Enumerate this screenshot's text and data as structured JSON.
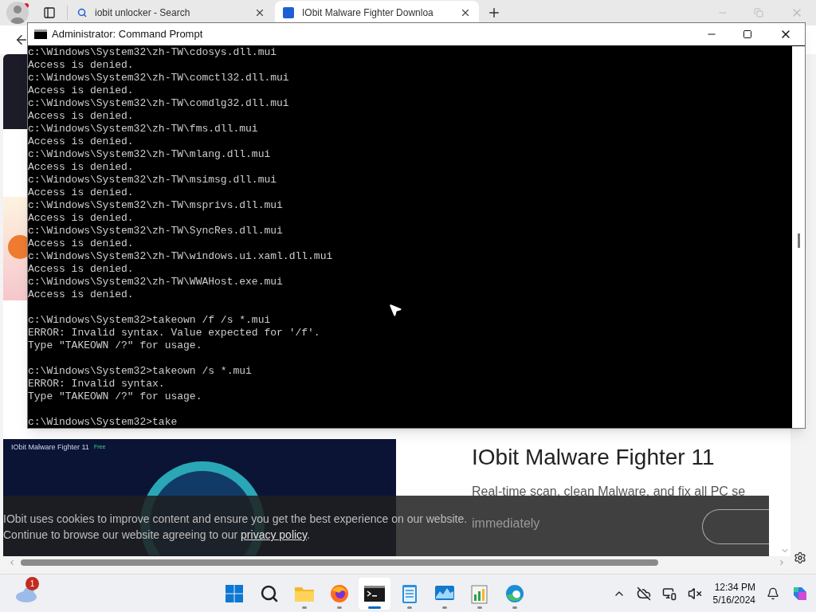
{
  "browser": {
    "tabs": [
      {
        "title": "iobit unlocker - Search",
        "selected": false,
        "kind": "search"
      },
      {
        "title": "IObit Malware Fighter Downloa",
        "selected": true,
        "kind": "site"
      }
    ],
    "page": {
      "app_shot": {
        "title": "IObit Malware Fighter 11",
        "badge": "Free"
      },
      "heading": "IObit Malware Fighter 11",
      "subtitle": "Real-time scan, clean Malware, and fix all PC se",
      "covered_text": "immediately",
      "cookie_banner": {
        "line_1": "IObit uses cookies to improve content and ensure you get the best experience on our website.",
        "line_2": "Continue to browse our website agreeing to our",
        "link": "privacy policy",
        "end": "."
      }
    }
  },
  "console": {
    "title": "Administrator: Command Prompt",
    "blocks": [
      [
        "c:\\Windows\\System32\\zh-TW\\cdosys.dll.mui",
        "Access is denied.",
        "c:\\Windows\\System32\\zh-TW\\comctl32.dll.mui",
        "Access is denied.",
        "c:\\Windows\\System32\\zh-TW\\comdlg32.dll.mui",
        "Access is denied.",
        "c:\\Windows\\System32\\zh-TW\\fms.dll.mui",
        "Access is denied.",
        "c:\\Windows\\System32\\zh-TW\\mlang.dll.mui",
        "Access is denied.",
        "c:\\Windows\\System32\\zh-TW\\msimsg.dll.mui",
        "Access is denied.",
        "c:\\Windows\\System32\\zh-TW\\msprivs.dll.mui",
        "Access is denied.",
        "c:\\Windows\\System32\\zh-TW\\SyncRes.dll.mui",
        "Access is denied.",
        "c:\\Windows\\System32\\zh-TW\\windows.ui.xaml.dll.mui",
        "Access is denied.",
        "c:\\Windows\\System32\\zh-TW\\WWAHost.exe.mui",
        "Access is denied."
      ],
      [
        "c:\\Windows\\System32>takeown /f /s *.mui",
        "ERROR: Invalid syntax. Value expected for '/f'.",
        "Type \"TAKEOWN /?\" for usage."
      ],
      [
        "c:\\Windows\\System32>takeown /s *.mui",
        "ERROR: Invalid syntax.",
        "Type \"TAKEOWN /?\" for usage."
      ],
      [
        "c:\\Windows\\System32>take"
      ]
    ]
  },
  "taskbar": {
    "weather_badge": "1",
    "apps": [
      {
        "kind": "start",
        "selected": false
      },
      {
        "kind": "search",
        "selected": false
      },
      {
        "kind": "folder",
        "selected": false
      },
      {
        "kind": "firefox",
        "selected": false
      },
      {
        "kind": "terminal",
        "selected": true
      },
      {
        "kind": "notepad",
        "selected": false
      },
      {
        "kind": "monitor",
        "selected": false
      },
      {
        "kind": "chart",
        "selected": false
      },
      {
        "kind": "edge",
        "selected": false
      }
    ],
    "time": "12:34 PM",
    "date": "5/16/2024"
  }
}
